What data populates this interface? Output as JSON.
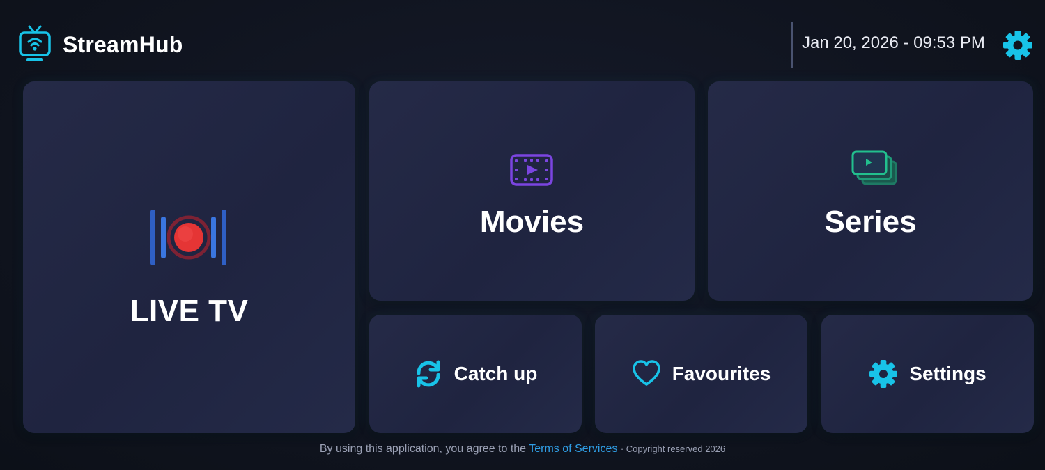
{
  "app": {
    "name": "StreamHub",
    "datetime": "Jan 20, 2026 - 09:53 PM",
    "accent_color": "#18c3e8",
    "icons": {
      "logo": "tv-wifi-icon",
      "settings": "gear-icon"
    }
  },
  "tiles": {
    "live_tv": {
      "label": "LIVE TV",
      "icon": "live-record-icon"
    },
    "movies": {
      "label": "Movies",
      "icon": "film-icon"
    },
    "series": {
      "label": "Series",
      "icon": "stacked-screens-icon"
    },
    "catch_up": {
      "label": "Catch up",
      "icon": "refresh-icon"
    },
    "favourites": {
      "label": "Favourites",
      "icon": "heart-icon"
    },
    "settings": {
      "label": "Settings",
      "icon": "gear-icon"
    }
  },
  "footer": {
    "text": "By using this application, you agree to the",
    "link": "Terms of Services",
    "copyright": "· Copyright reserved 2026"
  }
}
